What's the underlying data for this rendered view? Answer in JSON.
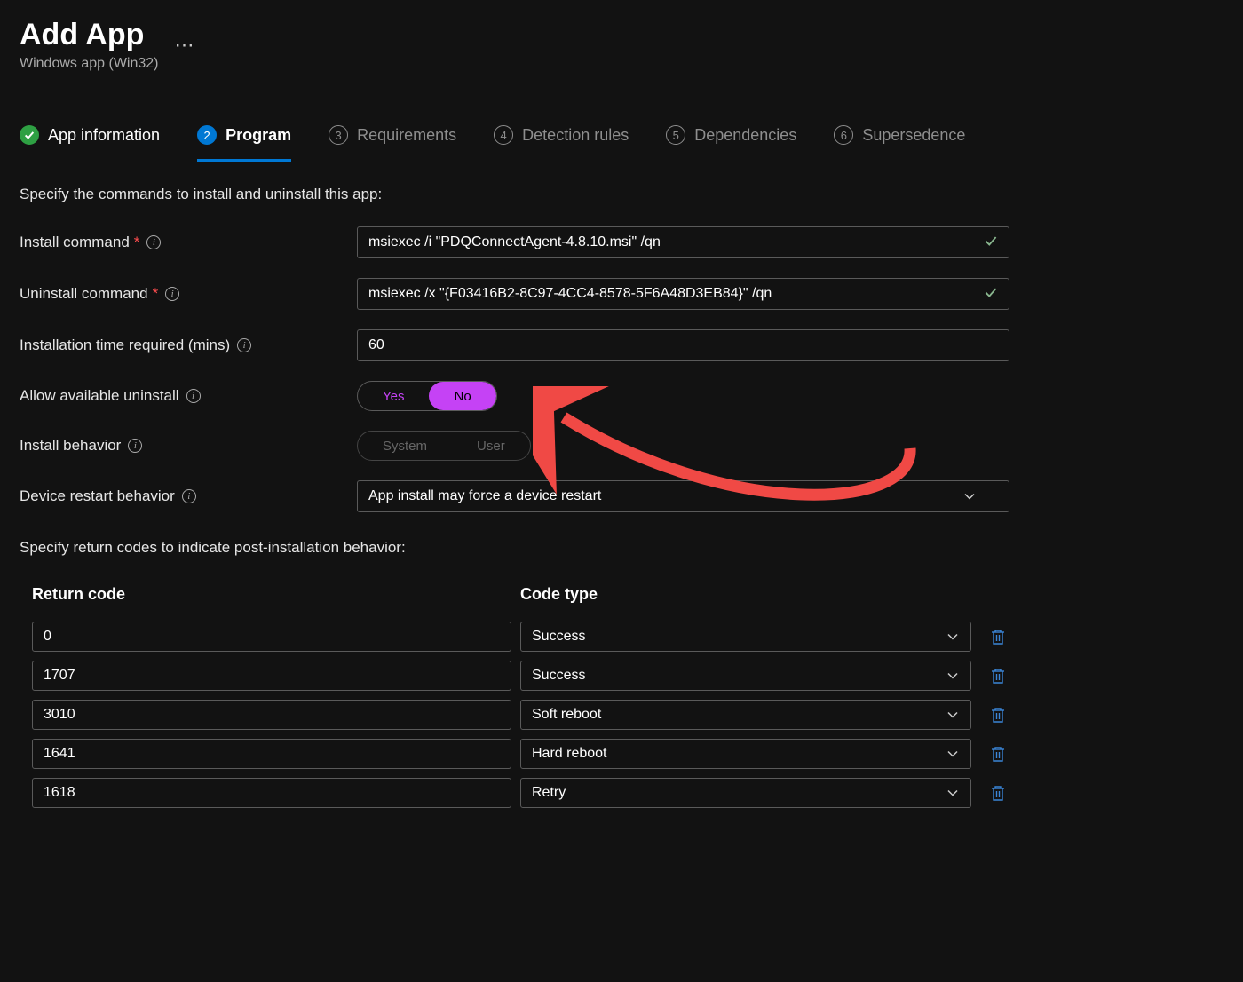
{
  "header": {
    "title": "Add App",
    "subtitle": "Windows app (Win32)"
  },
  "tabs": [
    {
      "label": "App information"
    },
    {
      "label": "Program"
    },
    {
      "label": "Requirements"
    },
    {
      "label": "Detection rules"
    },
    {
      "label": "Dependencies"
    },
    {
      "label": "Supersedence"
    }
  ],
  "section1_text": "Specify the commands to install and uninstall this app:",
  "fields": {
    "install_cmd_label": "Install command",
    "install_cmd_value": "msiexec /i \"PDQConnectAgent-4.8.10.msi\" /qn",
    "uninstall_cmd_label": "Uninstall command",
    "uninstall_cmd_value": "msiexec /x \"{F03416B2-8C97-4CC4-8578-5F6A48D3EB84}\" /qn",
    "install_time_label": "Installation time required (mins)",
    "install_time_value": "60",
    "allow_uninstall_label": "Allow available uninstall",
    "allow_uninstall_yes": "Yes",
    "allow_uninstall_no": "No",
    "install_behavior_label": "Install behavior",
    "install_behavior_system": "System",
    "install_behavior_user": "User",
    "restart_label": "Device restart behavior",
    "restart_value": "App install may force a device restart"
  },
  "section2_text": "Specify return codes to indicate post-installation behavior:",
  "table": {
    "col_return": "Return code",
    "col_type": "Code type",
    "rows": [
      {
        "code": "0",
        "type": "Success"
      },
      {
        "code": "1707",
        "type": "Success"
      },
      {
        "code": "3010",
        "type": "Soft reboot"
      },
      {
        "code": "1641",
        "type": "Hard reboot"
      },
      {
        "code": "1618",
        "type": "Retry"
      }
    ]
  }
}
